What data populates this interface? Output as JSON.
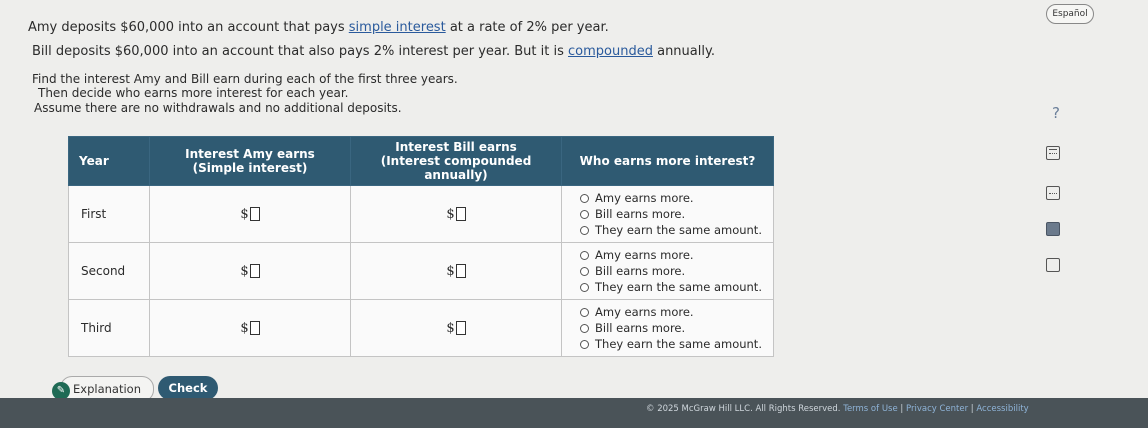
{
  "language_button": "Español",
  "question": {
    "line1_pre": "Amy deposits $60,000 into an account that pays ",
    "line1_link": "simple interest",
    "line1_post": " at a rate of 2% per year.",
    "line2_pre": "Bill deposits $60,000 into an account that also pays 2% interest per year. But it is ",
    "line2_link": "compounded",
    "line2_post": " annually.",
    "line3": "Find the interest Amy and Bill earn during each of the first three years.",
    "line4": "Then decide who earns more interest for each year.",
    "line5": "Assume there are no withdrawals and no additional deposits."
  },
  "table": {
    "headers": {
      "year": "Year",
      "amy": "Interest Amy earns",
      "amy_sub": "(Simple interest)",
      "bill": "Interest Bill earns",
      "bill_sub": "(Interest compounded annually)",
      "who": "Who earns more interest?"
    },
    "currency": "$",
    "rows": [
      {
        "year": "First",
        "options": [
          "Amy earns more.",
          "Bill earns more.",
          "They earn the same amount."
        ]
      },
      {
        "year": "Second",
        "options": [
          "Amy earns more.",
          "Bill earns more.",
          "They earn the same amount."
        ]
      },
      {
        "year": "Third",
        "options": [
          "Amy earns more.",
          "Bill earns more.",
          "They earn the same amount."
        ]
      }
    ]
  },
  "side_help": "?",
  "buttons": {
    "explanation": "Explanation",
    "check": "Check"
  },
  "footer": {
    "copyright": "© 2025 McGraw Hill LLC. All Rights Reserved.",
    "terms": "Terms of Use",
    "privacy": "Privacy Center",
    "accessibility": "Accessibility"
  }
}
